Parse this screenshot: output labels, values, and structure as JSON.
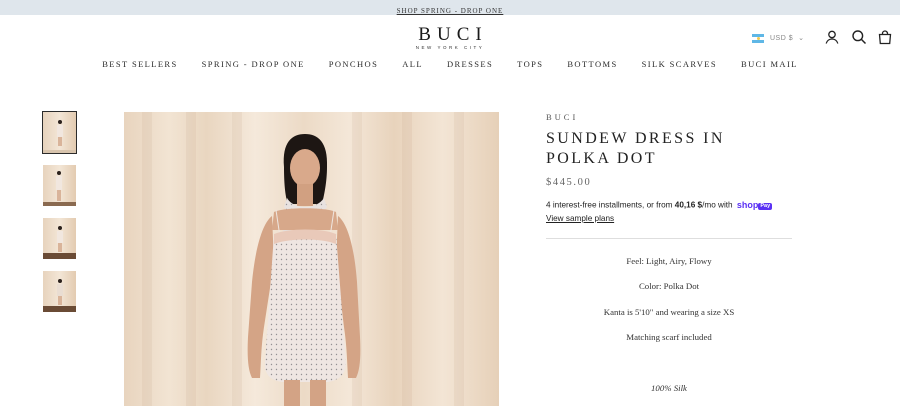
{
  "announcement": {
    "text": "SHOP SPRING - DROP ONE"
  },
  "header": {
    "logo_word": "BUCI",
    "logo_sub": "NEW YORK CITY",
    "currency": {
      "label": "USD $",
      "flag": "Argentina"
    }
  },
  "nav": {
    "items": [
      "BEST SELLERS",
      "SPRING - DROP ONE",
      "PONCHOS",
      "ALL",
      "DRESSES",
      "TOPS",
      "BOTTOMS",
      "SILK SCARVES",
      "BUCI MAIL"
    ]
  },
  "product": {
    "brand": "BUCI",
    "title": "SUNDEW DRESS IN POLKA DOT",
    "price": "$445.00",
    "installments_prefix": "4 interest-free installments, or from ",
    "installments_amount": "40,16 $",
    "installments_suffix": "/mo with ",
    "shoppay_text": "shop",
    "shoppay_badge": "Pay",
    "sample_plans": "View sample plans",
    "details": [
      "Feel: Light, Airy, Flowy",
      "Color: Polka Dot",
      "Kanta is 5'10\" and wearing a size XS",
      "Matching scarf included"
    ],
    "material": "100% Silk"
  },
  "gallery": {
    "thumbnail_count": 4,
    "active_index": 0
  },
  "colors": {
    "announcement_bg": "#dfe6ec",
    "shoppay_purple": "#5a31f4"
  }
}
